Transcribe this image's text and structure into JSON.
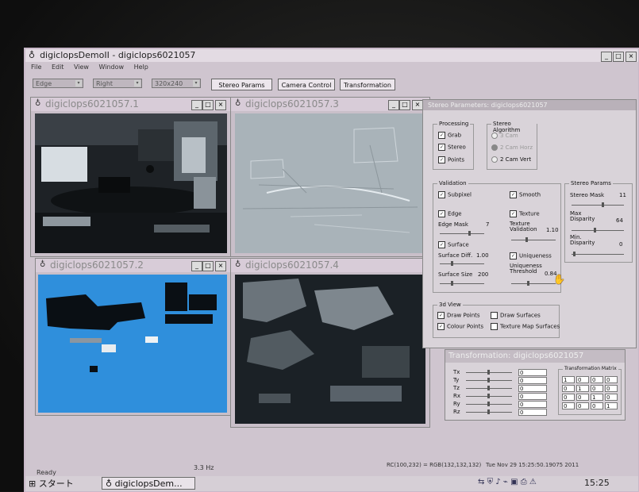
{
  "main_window": {
    "title": "digiclopsDemoII - digiclops6021057",
    "menu": [
      "File",
      "Edit",
      "View",
      "Window",
      "Help"
    ],
    "toolbar": {
      "combo_edge": "Edge",
      "combo_right": "Right",
      "combo_res": "320x240",
      "stereo_params_btn": "Stereo Params",
      "camera_control_btn": "Camera Control",
      "transformation_btn": "Transformation"
    }
  },
  "views": [
    {
      "title": "digiclops6021057.1"
    },
    {
      "title": "digiclops6021057.3"
    },
    {
      "title": "digiclops6021057.2"
    },
    {
      "title": "digiclops6021057.4"
    }
  ],
  "stereo_panel": {
    "title": "Stereo Parameters: digiclops6021057",
    "processing": {
      "label": "Processing",
      "grab": "Grab",
      "stereo": "Stereo",
      "points": "Points"
    },
    "algorithm": {
      "label": "Stereo Algorithm",
      "cam3": "3 Cam",
      "cam2h": "2 Cam Horz",
      "cam2v": "2 Cam Vert"
    },
    "validation": {
      "label": "Validation",
      "subpixel": "Subpixel",
      "smooth": "Smooth",
      "edge": "Edge",
      "texture": "Texture",
      "edge_mask": "Edge Mask",
      "edge_mask_value": "7",
      "texture_validation": "Texture Validation",
      "texture_validation_value": "1.10",
      "surface": "Surface",
      "uniqueness": "Uniqueness",
      "surface_diff": "Surface Diff.",
      "surface_diff_value": "1.00",
      "surface_size": "Surface Size",
      "surface_size_value": "200",
      "uniqueness_threshold": "Uniqueness Threshold",
      "uniqueness_threshold_value": "0.84"
    },
    "stereo_params": {
      "label": "Stereo Params",
      "stereo_mask": "Stereo Mask",
      "stereo_mask_value": "11",
      "max_disparity": "Max Disparity",
      "max_disparity_value": "64",
      "min_disparity": "Min. Disparity",
      "min_disparity_value": "0"
    },
    "view3d": {
      "label": "3d View",
      "draw_points": "Draw Points",
      "draw_surfaces": "Draw Surfaces",
      "colour_points": "Colour Points",
      "texture_map_surfaces": "Texture Map Surfaces"
    }
  },
  "transformation_panel": {
    "title": "Transformation: digiclops6021057",
    "rows": [
      {
        "label": "Tx",
        "value": "0"
      },
      {
        "label": "Ty",
        "value": "0"
      },
      {
        "label": "Tz",
        "value": "0"
      },
      {
        "label": "Rx",
        "value": "0"
      },
      {
        "label": "Ry",
        "value": "0"
      },
      {
        "label": "Rz",
        "value": "0"
      }
    ],
    "matrix_label": "Transformation Matrix",
    "matrix": [
      [
        "1",
        "0",
        "0",
        "0"
      ],
      [
        "0",
        "1",
        "0",
        "0"
      ],
      [
        "0",
        "0",
        "1",
        "0"
      ],
      [
        "0",
        "0",
        "0",
        "1"
      ]
    ]
  },
  "status_bar": {
    "ready": "Ready",
    "hz": "3.3 Hz",
    "pixel": "RC(100,232) = RGB(132,132,132)",
    "datetime": "Tue Nov 29 15:25:50.19075 2011"
  },
  "taskbar": {
    "start": "スタート",
    "task": "digiclopsDem...",
    "clock": "15:25"
  },
  "colors": {
    "disparity_blue": "#2f8fdc",
    "edge_gray": "#a9b3b9",
    "desktop": "#c9b9c9"
  }
}
